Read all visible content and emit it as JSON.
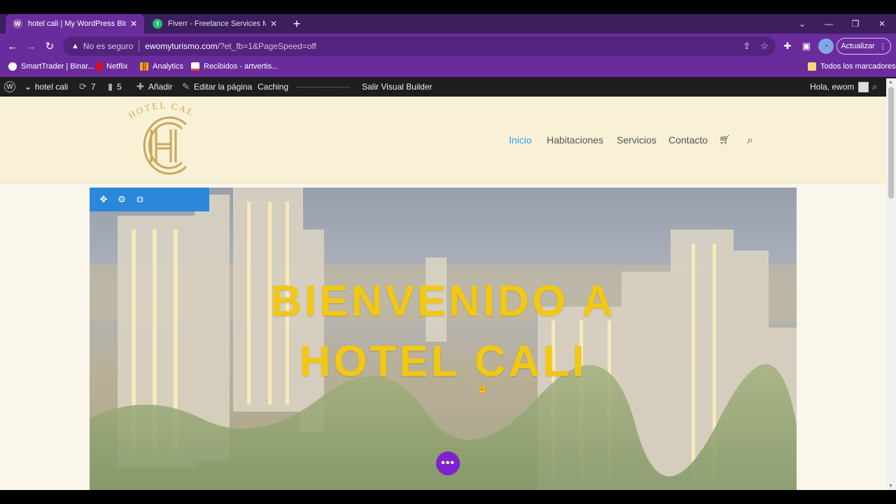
{
  "browser": {
    "tabs": [
      {
        "title": "hotel cali | My WordPress Blog",
        "active": true,
        "favicon": "wordpress-icon"
      },
      {
        "title": "Fiverr - Freelance Services Marke",
        "active": false,
        "favicon": "fiverr-icon"
      }
    ],
    "new_tab": "+",
    "close_glyph": "✕",
    "address": {
      "warning": "No es seguro",
      "host": "ewomyturismo.com",
      "path": "/?et_fb=1&PageSpeed=off"
    },
    "update_button": "Actualizar",
    "bookmarks": [
      {
        "label": "SmartTrader | Binar...",
        "icon": "smarttrader-icon",
        "color": "#ffffff"
      },
      {
        "label": "Netflix",
        "icon": "netflix-icon",
        "color": "#e50914"
      },
      {
        "label": "Analytics",
        "icon": "analytics-icon",
        "color": "#f9ab00"
      },
      {
        "label": "Recibidos - artvertis...",
        "icon": "gmail-icon",
        "color": "#ea4335"
      }
    ],
    "all_bookmarks": "Todos los marcadores"
  },
  "wp_admin_bar": {
    "site_name": "hotel cali",
    "updates_count": "7",
    "comments_count": "5",
    "add_label": "Añadir",
    "edit_page_label": "Editar la página",
    "caching_label": "Caching",
    "exit_builder_label": "Salir Visual Builder",
    "greeting": "Hola, ewom"
  },
  "site": {
    "logo_text": "HOTEL CALI",
    "logo_monogram": "CH",
    "nav": [
      {
        "label": "Inicio",
        "active": true
      },
      {
        "label": "Habitaciones",
        "active": false
      },
      {
        "label": "Servicios",
        "active": false
      },
      {
        "label": "Contacto",
        "active": false
      }
    ],
    "hero_title_line1": "BIENVENIDO A",
    "hero_title_line2": "HOTEL CALI",
    "module_toolbar": [
      "move-icon",
      "settings-icon",
      "duplicate-icon"
    ],
    "more_button": "•••"
  },
  "colors": {
    "tab_bar": "#3b1f5e",
    "toolbar": "#6a2c9c",
    "wp_bar": "#1e1e1e",
    "header_bg": "#f8f1d6",
    "logo_gold": "#c9a85c",
    "nav_active": "#2ea3f2",
    "hero_title": "#f2c812",
    "builder_blue": "#2b87da",
    "builder_purple": "#7e22ce"
  }
}
